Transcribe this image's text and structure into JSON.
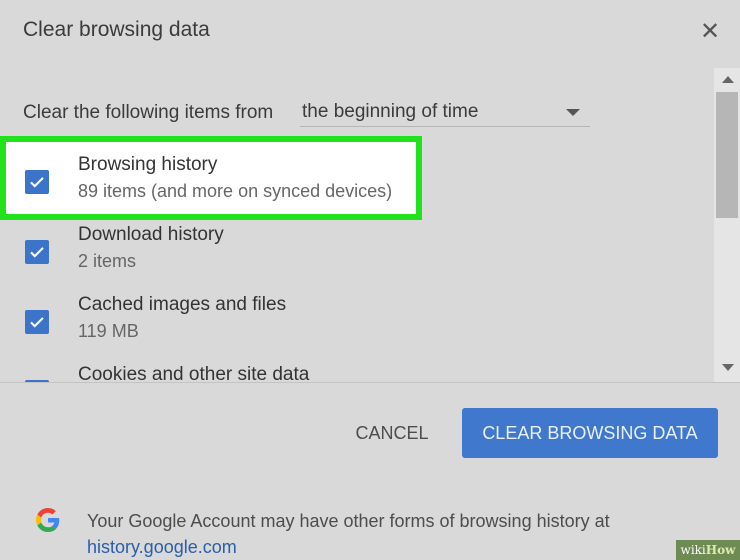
{
  "dialog": {
    "title": "Clear browsing data",
    "close_icon": "close-icon"
  },
  "range": {
    "label": "Clear the following items from",
    "selected": "the beginning of time"
  },
  "items": [
    {
      "title": "Browsing history",
      "subtitle": "89 items (and more on synced devices)",
      "checked": true,
      "highlighted": true
    },
    {
      "title": "Download history",
      "subtitle": "2 items",
      "checked": true
    },
    {
      "title": "Cached images and files",
      "subtitle": "119 MB",
      "checked": true
    },
    {
      "title": "Cookies and other site data",
      "subtitle": "",
      "checked": true
    }
  ],
  "actions": {
    "cancel": "CANCEL",
    "clear": "CLEAR BROWSING DATA"
  },
  "footer": {
    "text_line1": "Your Google Account may have other forms of browsing history at",
    "link": "history.google.com"
  },
  "watermark": {
    "part1": "wiki",
    "part2": "How"
  },
  "colors": {
    "accent": "#3f78cc",
    "checkbox": "#3b74c9",
    "highlight": "#21e21d",
    "background": "#d9d9d9"
  }
}
